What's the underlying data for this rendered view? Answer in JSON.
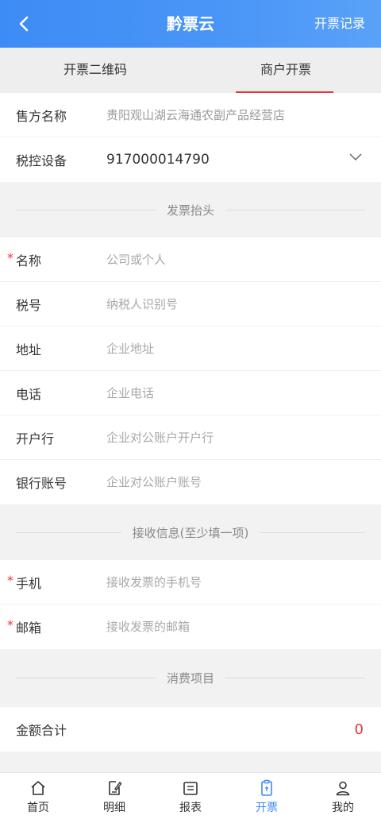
{
  "header": {
    "title": "黔票云",
    "right_link": "开票记录"
  },
  "tabs": [
    {
      "label": "开票二维码",
      "active": false
    },
    {
      "label": "商户开票",
      "active": true
    }
  ],
  "seller": {
    "name_label": "售方名称",
    "name_value": "贵阳观山湖云海通农副产品经营店",
    "device_label": "税控设备",
    "device_value": "917000014790"
  },
  "invoice_header": {
    "section_title": "发票抬头",
    "fields": [
      {
        "label": "名称",
        "placeholder": "公司或个人",
        "required": true
      },
      {
        "label": "税号",
        "placeholder": "纳税人识别号",
        "required": false
      },
      {
        "label": "地址",
        "placeholder": "企业地址",
        "required": false
      },
      {
        "label": "电话",
        "placeholder": "企业电话",
        "required": false
      },
      {
        "label": "开户行",
        "placeholder": "企业对公账户开户行",
        "required": false
      },
      {
        "label": "银行账号",
        "placeholder": "企业对公账户账号",
        "required": false
      }
    ]
  },
  "receive_info": {
    "section_title": "接收信息(至少填一项)",
    "fields": [
      {
        "label": "手机",
        "placeholder": "接收发票的手机号",
        "required": true
      },
      {
        "label": "邮箱",
        "placeholder": "接收发票的邮箱",
        "required": true
      }
    ]
  },
  "consumption": {
    "section_title": "消费项目",
    "total_label": "金额合计",
    "total_value": "0"
  },
  "required_mark": "*",
  "nav": [
    {
      "label": "首页",
      "icon": "home-icon",
      "active": false
    },
    {
      "label": "明细",
      "icon": "edit-doc-icon",
      "active": false
    },
    {
      "label": "报表",
      "icon": "report-icon",
      "active": false
    },
    {
      "label": "开票",
      "icon": "invoice-icon",
      "active": true
    },
    {
      "label": "我的",
      "icon": "user-icon",
      "active": false
    }
  ],
  "colors": {
    "header_blue": "#3d8bf5",
    "accent_red": "#e8353a",
    "active_nav": "#3d8bf5"
  }
}
